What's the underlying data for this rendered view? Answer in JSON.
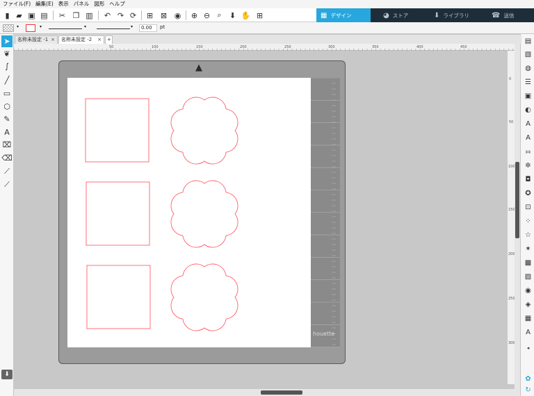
{
  "menu": [
    "ファイル(F)",
    "編集(E)",
    "表示",
    "パネル",
    "図形",
    "ヘルプ"
  ],
  "toolbar_icons": [
    "new-icon",
    "open-icon",
    "save-icon",
    "print-icon",
    "cut-icon",
    "copy-icon",
    "paste-icon",
    "undo-icon",
    "redo-icon",
    "rotate-icon",
    "group-icon",
    "ungroup-icon",
    "select-all-icon",
    "zoom-in-icon",
    "zoom-out-icon",
    "zoom-fit-icon",
    "move-down-icon",
    "pan-icon",
    "add-page-icon"
  ],
  "nav_tabs": [
    {
      "label": "デザイン",
      "icon": "grid-icon",
      "active": true
    },
    {
      "label": "ストア",
      "icon": "store-icon",
      "active": false
    },
    {
      "label": "ライブラリ",
      "icon": "library-icon",
      "active": false
    },
    {
      "label": "送信",
      "icon": "send-icon",
      "active": false
    }
  ],
  "line_settings": {
    "line_width": "0.00",
    "unit": "pt"
  },
  "doc_tabs": [
    {
      "label": "名称未設定 -1",
      "active": false
    },
    {
      "label": "名称未設定 -2",
      "active": true
    }
  ],
  "add_tab_label": "+",
  "ruler_top_labels": [
    "50",
    "100",
    "150",
    "200",
    "250",
    "300",
    "350",
    "400",
    "450"
  ],
  "ruler_side_labels": [
    "0",
    "50",
    "100",
    "150",
    "200",
    "250",
    "300"
  ],
  "mat_brand_label": "houette",
  "colors": {
    "accent": "#27a7dd",
    "cut_line": "#ff4b5a",
    "mat": "#9b9b9b",
    "nav_bg": "#1e2d3a"
  }
}
